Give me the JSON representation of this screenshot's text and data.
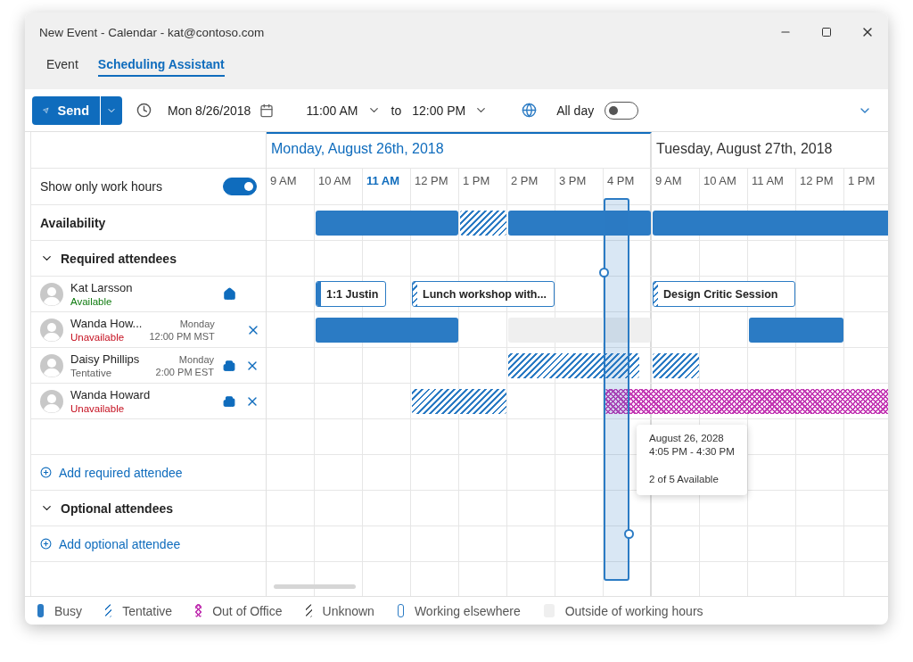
{
  "window": {
    "title": "New Event - Calendar - kat@contoso.com"
  },
  "tabs": [
    {
      "label": "Event",
      "selected": false
    },
    {
      "label": "Scheduling Assistant",
      "selected": true
    }
  ],
  "toolbar": {
    "send": "Send",
    "date": "Mon 8/26/2018",
    "start_time": "11:00 AM",
    "to": "to",
    "end_time": "12:00 PM",
    "all_day": {
      "label": "All day",
      "on": false
    }
  },
  "days": [
    {
      "label": "Monday, August 26th, 2018",
      "selected": true,
      "hours": [
        {
          "label": "9 AM",
          "selected": false
        },
        {
          "label": "10 AM",
          "selected": false
        },
        {
          "label": "11 AM",
          "selected": true
        },
        {
          "label": "12 PM",
          "selected": false
        },
        {
          "label": "1 PM",
          "selected": false
        },
        {
          "label": "2 PM",
          "selected": false
        },
        {
          "label": "3 PM",
          "selected": false
        },
        {
          "label": "4 PM",
          "selected": false
        }
      ]
    },
    {
      "label": "Tuesday, August 27th, 2018",
      "selected": false,
      "hours": [
        {
          "label": "9 AM",
          "selected": false
        },
        {
          "label": "10 AM",
          "selected": false
        },
        {
          "label": "11 AM",
          "selected": false
        },
        {
          "label": "12 PM",
          "selected": false
        },
        {
          "label": "1 PM",
          "selected": false
        }
      ]
    }
  ],
  "work_hours": {
    "label": "Show only work hours",
    "on": true
  },
  "availability": {
    "label": "Availability",
    "blocks": [
      {
        "kind": "busy"
      },
      {
        "kind": "tentative"
      },
      {
        "kind": "busy"
      },
      {
        "kind": "busy"
      }
    ]
  },
  "required": {
    "label": "Required attendees",
    "expanded": true,
    "add": "Add required attendee"
  },
  "attendees": [
    {
      "name": "Kat Larsson",
      "status": {
        "label": "Available",
        "color": "#107c10"
      },
      "location": {
        "kind": "home"
      },
      "removable": false,
      "blocks": [
        {
          "kind": "busy",
          "title": "1:1 Justin"
        },
        {
          "kind": "tentative",
          "title": "Lunch workshop with..."
        },
        {
          "kind": "tentative",
          "title": "Design Critic Session"
        }
      ]
    },
    {
      "name": "Wanda How...",
      "status": {
        "label": "Unavailable",
        "color": "#c50f1f"
      },
      "local_day": "Monday",
      "local_time": "12:00 PM MST",
      "removable": true,
      "blocks": [
        {
          "kind": "busy"
        },
        {
          "kind": "outside"
        },
        {
          "kind": "busy"
        }
      ]
    },
    {
      "name": "Daisy Phillips",
      "status": {
        "label": "Tentative",
        "color": "#616161"
      },
      "local_day": "Monday",
      "local_time": "2:00 PM EST",
      "location": {
        "kind": "office"
      },
      "removable": true,
      "blocks": [
        {
          "kind": "tentative"
        },
        {
          "kind": "tentative"
        }
      ]
    },
    {
      "name": "Wanda Howard",
      "status": {
        "label": "Unavailable",
        "color": "#c50f1f"
      },
      "location": {
        "kind": "office"
      },
      "removable": true,
      "blocks": [
        {
          "kind": "tentative"
        },
        {
          "kind": "oof"
        }
      ]
    }
  ],
  "optional": {
    "label": "Optional attendees",
    "expanded": true,
    "add": "Add optional attendee"
  },
  "tooltip": {
    "date": "August 26, 2028",
    "time": "4:05 PM - 4:30 PM",
    "summary": "2 of 5 Available"
  },
  "legend": [
    {
      "kind": "busy",
      "label": "Busy"
    },
    {
      "kind": "tentative",
      "label": "Tentative"
    },
    {
      "kind": "oof",
      "label": "Out of Office"
    },
    {
      "kind": "unknown",
      "label": "Unknown"
    },
    {
      "kind": "elsewhere",
      "label": "Working elsewhere"
    },
    {
      "kind": "outside",
      "label": "Outside of working hours"
    }
  ]
}
